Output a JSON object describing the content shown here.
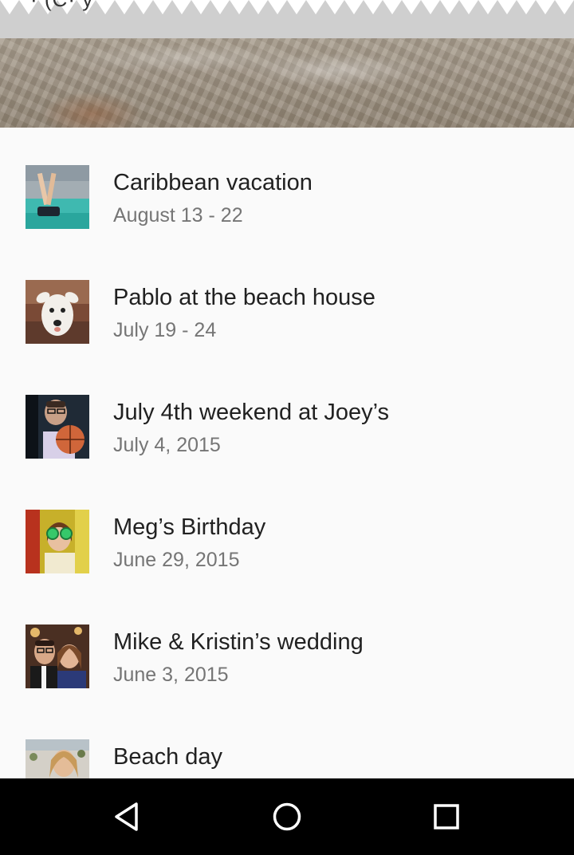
{
  "header": {
    "torn_title": "· (C·   y"
  },
  "list": {
    "items": [
      {
        "title": "Caribbean vacation",
        "subtitle": "August 13 - 22",
        "thumb": "person-diving-in-turquoise-water-photo"
      },
      {
        "title": "Pablo at the beach house",
        "subtitle": "July 19 - 24",
        "thumb": "white-dog-photo"
      },
      {
        "title": "July 4th weekend at Joey’s",
        "subtitle": "July 4, 2015",
        "thumb": "man-holding-basketball-photo"
      },
      {
        "title": "Meg’s Birthday",
        "subtitle": "June 29, 2015",
        "thumb": "woman-with-party-glasses-photo"
      },
      {
        "title": "Mike & Kristin’s wedding",
        "subtitle": "June 3, 2015",
        "thumb": "couple-selfie-photo"
      },
      {
        "title": "Beach day",
        "subtitle": "",
        "thumb": "smiling-woman-at-beach-photo"
      }
    ]
  },
  "navbar": {
    "back_icon": "back-triangle-icon",
    "home_icon": "home-circle-icon",
    "recents_icon": "recents-square-icon"
  },
  "colors": {
    "background": "#fafafa",
    "navbar": "#000000",
    "title_text": "#212121",
    "subtitle_text": "#757575"
  }
}
